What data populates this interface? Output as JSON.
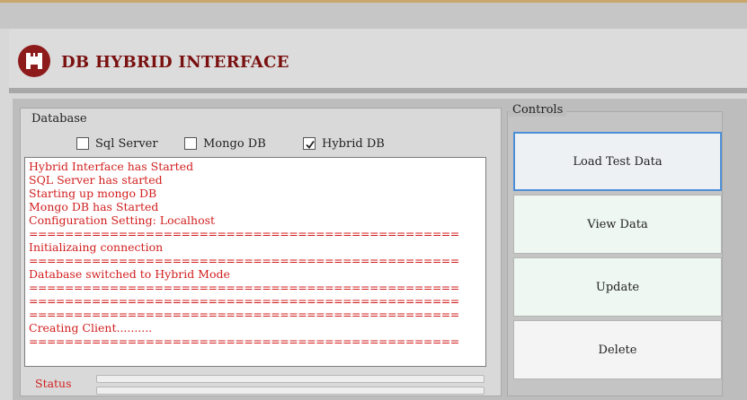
{
  "app": {
    "title": "DB HYBRID INTERFACE",
    "accent_color": "#8e1b1b",
    "logo_icon": "castle-logo-icon"
  },
  "database_panel": {
    "label": "Database",
    "options": [
      {
        "label": "Sql Server",
        "checked": false
      },
      {
        "label": "Mongo DB",
        "checked": false
      },
      {
        "label": "Hybrid DB",
        "checked": true
      }
    ],
    "log_color": "#d21e1e",
    "log_lines": [
      "Hybrid Interface has Started",
      "SQL Server has started",
      "Starting up mongo DB",
      "Mongo DB has Started",
      "Configuration Setting: Localhost",
      "================================================",
      "Initializaing connection",
      "================================================",
      "Database switched to Hybrid Mode",
      "================================================",
      "================================================",
      "================================================",
      "Creating Client..........",
      "================================================"
    ]
  },
  "status": {
    "label": "Status"
  },
  "controls": {
    "label": "Controls",
    "buttons": {
      "load_test_data": "Load Test Data",
      "view_data": "View Data",
      "update": "Update",
      "delete": "Delete"
    }
  }
}
